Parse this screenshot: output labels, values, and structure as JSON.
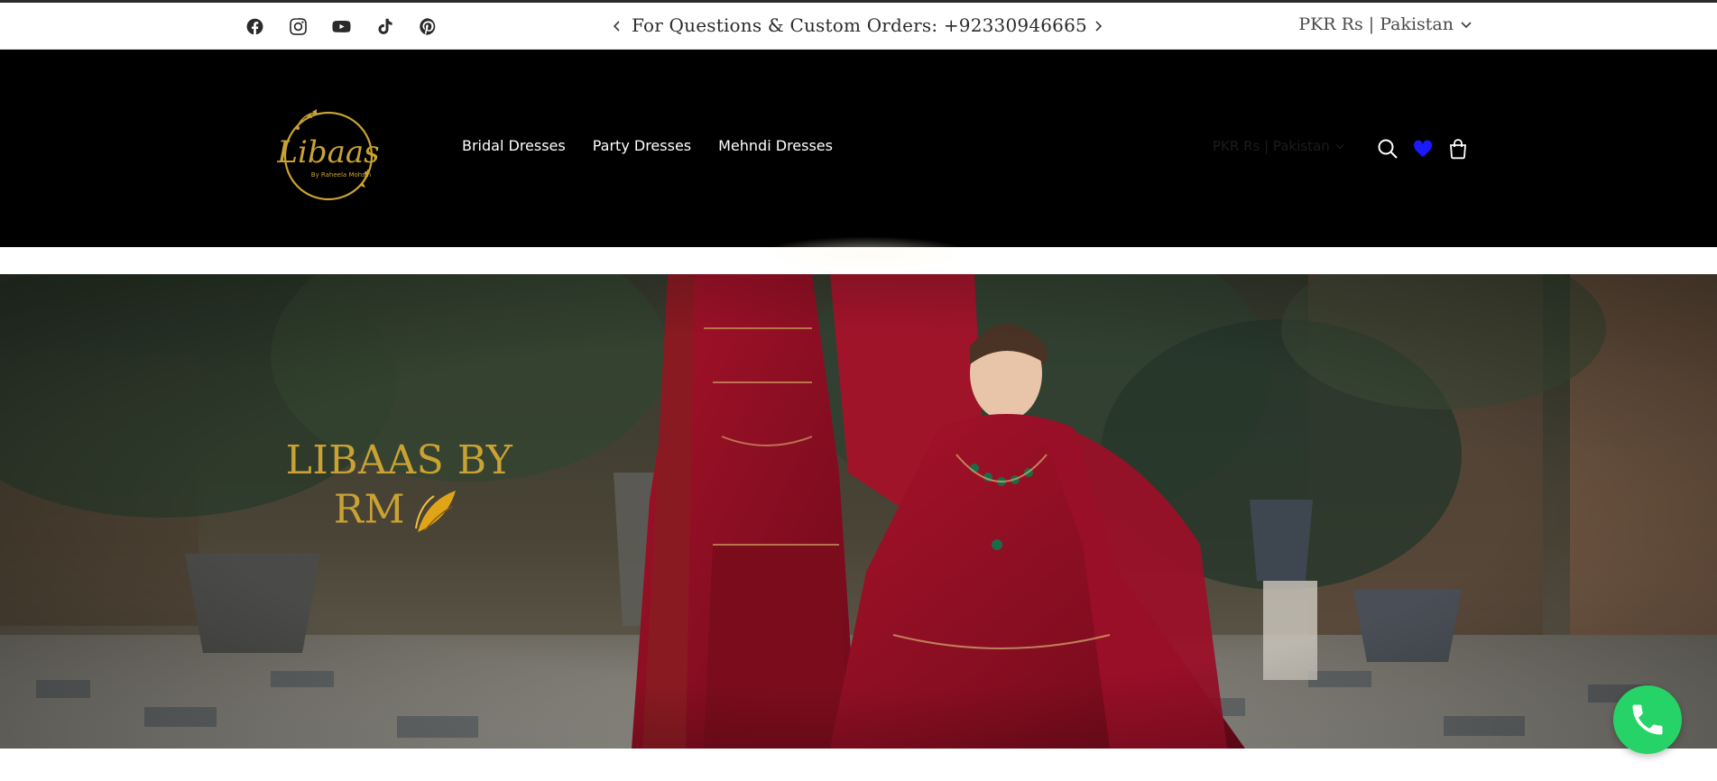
{
  "announcement_bar": {
    "social_links": [
      {
        "icon": "facebook-icon"
      },
      {
        "icon": "instagram-icon"
      },
      {
        "icon": "youtube-icon"
      },
      {
        "icon": "tiktok-icon"
      },
      {
        "icon": "pinterest-icon"
      }
    ],
    "message": "For Questions & Custom Orders: +92330946665",
    "country_selector": "PKR Rs | Pakistan"
  },
  "header": {
    "logo_text": "Libaas",
    "logo_subtext": "By Raheela Mohsin",
    "nav": [
      {
        "label": "Bridal Dresses"
      },
      {
        "label": "Party Dresses"
      },
      {
        "label": "Mehndi Dresses"
      }
    ],
    "country_selector": "PKR Rs | Pakistan",
    "icons": [
      "search-icon",
      "heart-icon",
      "cart-icon"
    ]
  },
  "hero": {
    "title_line1": "LIBAAS BY",
    "title_line2": "RM"
  },
  "colors": {
    "header_bg": "#000000",
    "hero_title": "#c9a233",
    "heart": "#1a1aff",
    "whatsapp": "#25d366"
  }
}
